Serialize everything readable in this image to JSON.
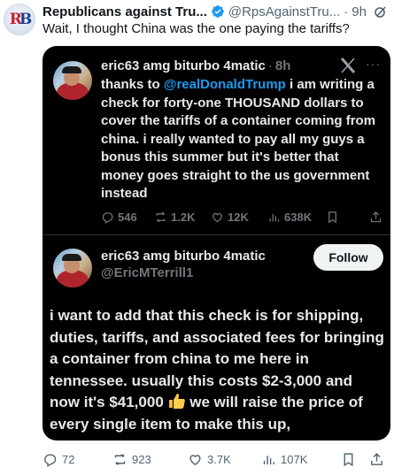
{
  "outer_tweet": {
    "author_name": "Republicans against Tru...",
    "handle": "@RpsAgainstTru...",
    "dot": "·",
    "time": "9h",
    "text": "Wait, I thought China was the one paying the tariffs?",
    "actions": {
      "replies": "72",
      "reposts": "923",
      "likes": "3.7K",
      "views": "107K"
    },
    "avatar_logo": "RB"
  },
  "quoted_tweet": {
    "author_name": "eric63 amg biturbo 4matic",
    "dot": "·",
    "time": "8h",
    "text_before_mention": "thanks to ",
    "mention": "@realDonaldTrump",
    "text_after_mention": " i am writing a check for forty-one THOUSAND dollars to cover the tariffs of a container coming from china. i really wanted to pay all my guys a bonus this summer but it's better that money goes straight to the us government instead",
    "actions": {
      "replies": "546",
      "reposts": "1.2K",
      "likes": "12K",
      "views": "638K"
    }
  },
  "embedded_post": {
    "author_name": "eric63 amg biturbo 4matic",
    "handle": "@EricMTerrill1",
    "follow_label": "Follow",
    "text_part1": "i want to add that this check is for shipping, duties, tariffs, and associated fees for bringing a container from china to me here in tennessee. usually this costs $2-3,000 and now it's $41,000 ",
    "text_part2": " we will raise the price of every single item to make this up,"
  },
  "icons": [
    "verified-badge-icon",
    "grok-icon",
    "more-icon",
    "x-logo-icon",
    "reply-icon",
    "repost-icon",
    "like-icon",
    "views-icon",
    "bookmark-icon",
    "share-icon",
    "thumbs-up-emoji"
  ],
  "colors": {
    "link": "#1d9bf0",
    "verified": "#1d9bf0",
    "card_bg": "#000000",
    "muted": "#536471"
  }
}
